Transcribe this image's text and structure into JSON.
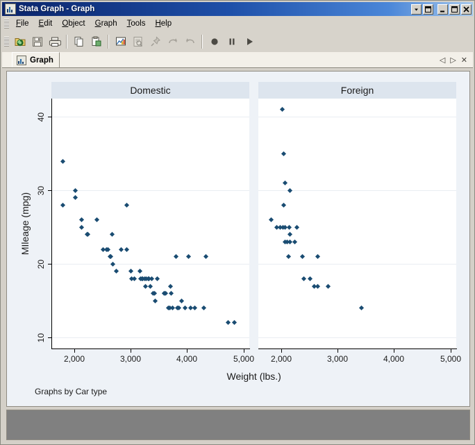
{
  "window": {
    "title": "Stata Graph - Graph",
    "icon": "stata-graph-icon",
    "buttons": [
      {
        "name": "window-menu-dropdown",
        "glyph": "dropdown"
      },
      {
        "name": "restore-window-button",
        "glyph": "restore"
      },
      {
        "name": "minimize-window-button",
        "glyph": "minimize"
      },
      {
        "name": "maximize-window-button",
        "glyph": "maximize"
      },
      {
        "name": "close-window-button",
        "glyph": "close"
      }
    ]
  },
  "menubar": {
    "items": [
      {
        "label": "File",
        "mnemonic": "F"
      },
      {
        "label": "Edit",
        "mnemonic": "E"
      },
      {
        "label": "Object",
        "mnemonic": "O"
      },
      {
        "label": "Graph",
        "mnemonic": "G"
      },
      {
        "label": "Tools",
        "mnemonic": "T"
      },
      {
        "label": "Help",
        "mnemonic": "H"
      }
    ]
  },
  "toolbar": {
    "items": [
      {
        "name": "open-button",
        "icon": "open-folder-icon",
        "disabled": false
      },
      {
        "name": "save-button",
        "icon": "save-disk-icon",
        "disabled": false
      },
      {
        "name": "print-button",
        "icon": "printer-icon",
        "disabled": false
      },
      {
        "name": "separator-1",
        "icon": "separator",
        "disabled": false
      },
      {
        "name": "copy-button",
        "icon": "copy-icon",
        "disabled": false
      },
      {
        "name": "paste-button",
        "icon": "paste-icon",
        "disabled": false
      },
      {
        "name": "separator-2",
        "icon": "separator",
        "disabled": false
      },
      {
        "name": "graph-editor-button",
        "icon": "graph-editor-icon",
        "disabled": false
      },
      {
        "name": "object-browser-button",
        "icon": "object-browser-icon",
        "disabled": true
      },
      {
        "name": "grid-edit-button",
        "icon": "pushpin-icon",
        "disabled": true
      },
      {
        "name": "undo-button",
        "icon": "undo-arrow-icon",
        "disabled": true
      },
      {
        "name": "redo-button",
        "icon": "redo-arrow-icon",
        "disabled": true
      },
      {
        "name": "separator-3",
        "icon": "separator",
        "disabled": false
      },
      {
        "name": "record-button",
        "icon": "record-circle-icon",
        "disabled": false
      },
      {
        "name": "pause-button",
        "icon": "pause-icon",
        "disabled": false
      },
      {
        "name": "play-button",
        "icon": "play-triangle-icon",
        "disabled": false
      }
    ]
  },
  "tabstrip": {
    "tabs": [
      {
        "label": "Graph",
        "icon": "graph-tab-icon",
        "active": true
      }
    ],
    "controls": [
      {
        "name": "tab-scroll-left-button",
        "glyph": "◁"
      },
      {
        "name": "tab-scroll-right-button",
        "glyph": "▷"
      },
      {
        "name": "tab-close-button",
        "glyph": "✕"
      }
    ]
  },
  "chart_data": {
    "type": "scatter",
    "title": "",
    "note": "Graphs by Car type",
    "xlabel": "Weight (lbs.)",
    "ylabel": "MIleage (mpg)",
    "xlim": [
      1600,
      5100
    ],
    "ylim": [
      8.5,
      42.5
    ],
    "xticks": [
      2000,
      3000,
      4000,
      5000
    ],
    "xticklabels": [
      "2,000",
      "3,000",
      "4,000",
      "5,000"
    ],
    "yticks": [
      10,
      20,
      30,
      40
    ],
    "yticklabels": [
      "10",
      "20",
      "30",
      "40"
    ],
    "grid": "horizontal",
    "legend": "none",
    "marker_color": "#1a4c72",
    "marker_symbol": "diamond",
    "panel_header_color": "#dde5ee",
    "background_color": "#eef2f7",
    "plot_background_color": "#ffffff",
    "panels": [
      {
        "label": "Domestic",
        "points": [
          [
            1800,
            34
          ],
          [
            1800,
            28
          ],
          [
            2020,
            30
          ],
          [
            2020,
            29
          ],
          [
            2130,
            26
          ],
          [
            2130,
            25
          ],
          [
            2230,
            24
          ],
          [
            2240,
            24
          ],
          [
            2410,
            26
          ],
          [
            2520,
            22
          ],
          [
            2580,
            22
          ],
          [
            2600,
            22
          ],
          [
            2640,
            21
          ],
          [
            2650,
            21
          ],
          [
            2670,
            24
          ],
          [
            2690,
            20
          ],
          [
            2750,
            19
          ],
          [
            2830,
            22
          ],
          [
            2930,
            28
          ],
          [
            2930,
            22
          ],
          [
            3000,
            19
          ],
          [
            3020,
            18
          ],
          [
            3070,
            18
          ],
          [
            3170,
            19
          ],
          [
            3180,
            18
          ],
          [
            3200,
            18
          ],
          [
            3210,
            18
          ],
          [
            3250,
            18
          ],
          [
            3260,
            17
          ],
          [
            3280,
            18
          ],
          [
            3310,
            18
          ],
          [
            3330,
            18
          ],
          [
            3350,
            17
          ],
          [
            3370,
            18
          ],
          [
            3400,
            16
          ],
          [
            3420,
            16
          ],
          [
            3430,
            15
          ],
          [
            3470,
            18
          ],
          [
            3600,
            16
          ],
          [
            3600,
            16
          ],
          [
            3620,
            16
          ],
          [
            3670,
            14
          ],
          [
            3690,
            14
          ],
          [
            3700,
            17
          ],
          [
            3720,
            16
          ],
          [
            3740,
            14
          ],
          [
            3800,
            21
          ],
          [
            3830,
            14
          ],
          [
            3850,
            14
          ],
          [
            3900,
            15
          ],
          [
            3960,
            14
          ],
          [
            4030,
            21
          ],
          [
            4060,
            14
          ],
          [
            4130,
            14
          ],
          [
            4290,
            14
          ],
          [
            4330,
            21
          ],
          [
            4720,
            12
          ],
          [
            4840,
            12
          ]
        ]
      },
      {
        "label": "Foreign",
        "points": [
          [
            2020,
            41
          ],
          [
            2050,
            35
          ],
          [
            2070,
            31
          ],
          [
            2160,
            30
          ],
          [
            2050,
            28
          ],
          [
            1830,
            26
          ],
          [
            1930,
            25
          ],
          [
            1990,
            25
          ],
          [
            2040,
            25
          ],
          [
            2070,
            25
          ],
          [
            2150,
            25
          ],
          [
            2280,
            25
          ],
          [
            2160,
            24
          ],
          [
            2070,
            23
          ],
          [
            2110,
            23
          ],
          [
            2160,
            23
          ],
          [
            2240,
            23
          ],
          [
            2130,
            21
          ],
          [
            2380,
            21
          ],
          [
            2650,
            21
          ],
          [
            2410,
            18
          ],
          [
            2520,
            18
          ],
          [
            2590,
            17
          ],
          [
            2650,
            17
          ],
          [
            2830,
            17
          ],
          [
            3420,
            14
          ]
        ]
      }
    ]
  }
}
